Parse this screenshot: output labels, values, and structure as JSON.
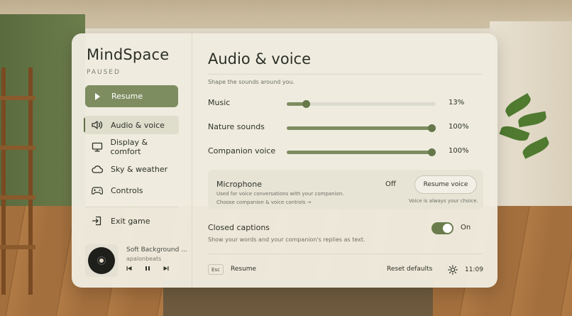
{
  "app": {
    "title": "MindSpace",
    "status": "PAUSED"
  },
  "sidebar": {
    "resume_label": "Resume",
    "items": [
      {
        "label": "Audio & voice",
        "icon": "speaker-icon",
        "active": true
      },
      {
        "label": "Display & comfort",
        "icon": "monitor-icon",
        "active": false
      },
      {
        "label": "Sky & weather",
        "icon": "cloud-icon",
        "active": false
      },
      {
        "label": "Controls",
        "icon": "gamepad-icon",
        "active": false
      }
    ],
    "exit_label": "Exit game"
  },
  "player": {
    "track": "Soft Background ...",
    "artist": "apalonbeats",
    "icons": [
      "vinyl-record-icon",
      "skip-back-icon",
      "pause-icon",
      "skip-forward-icon"
    ]
  },
  "main": {
    "title": "Audio & voice",
    "subtitle": "Shape the sounds around you.",
    "sliders": [
      {
        "label": "Music",
        "value": 13,
        "display": "13%"
      },
      {
        "label": "Nature sounds",
        "value": 100,
        "display": "100%"
      },
      {
        "label": "Companion voice",
        "value": 100,
        "display": "100%"
      }
    ],
    "microphone": {
      "title": "Microphone",
      "description": "Used for voice conversations with your companion.",
      "link": "Choose companion & voice controls →",
      "state": "Off",
      "button": "Resume voice",
      "note": "Voice is always your choice."
    },
    "captions": {
      "title": "Closed captions",
      "description": "Show your words and your companion's replies as text.",
      "state": "On",
      "enabled": true
    }
  },
  "footer": {
    "esc_key": "Esc",
    "resume_label": "Resume",
    "reset_label": "Reset defaults",
    "time": "11:09"
  },
  "colors": {
    "accent": "#7d8d60",
    "panel": "#efece0",
    "text": "#2e3128"
  }
}
